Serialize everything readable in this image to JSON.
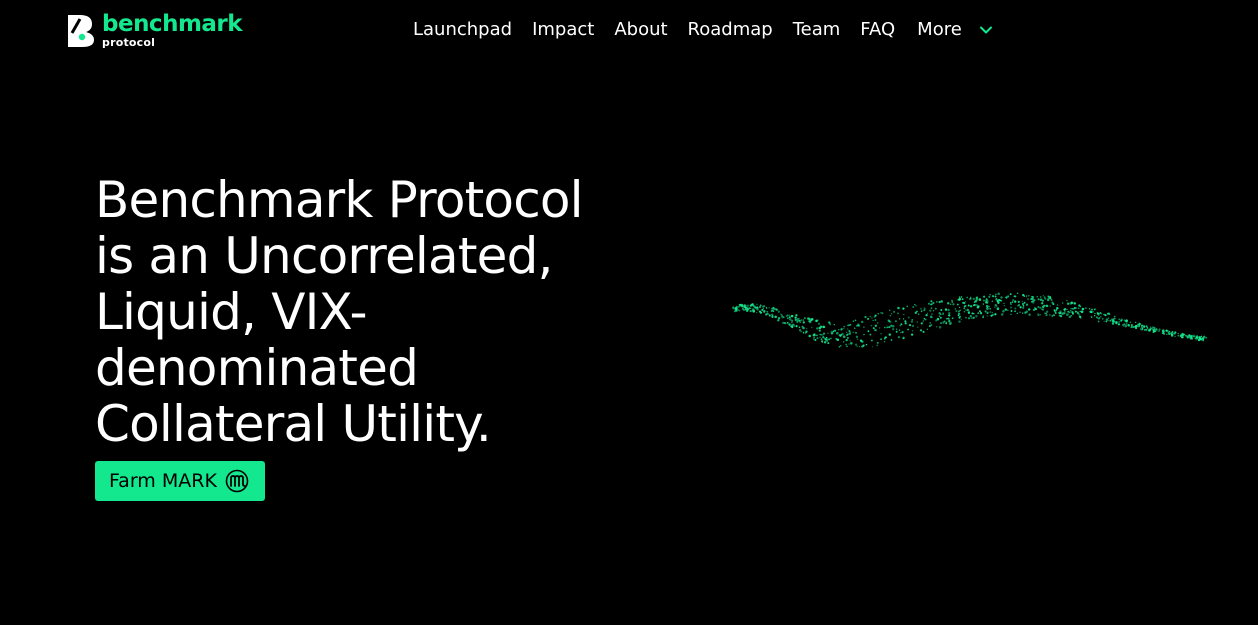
{
  "logo": {
    "name": "benchmark",
    "sub": "protocol"
  },
  "nav": {
    "items": [
      "Launchpad",
      "Impact",
      "About",
      "Roadmap",
      "Team",
      "FAQ"
    ],
    "more_label": "More"
  },
  "hero": {
    "title_lines": [
      "Benchmark Protocol",
      "is an Uncorrelated,",
      "Liquid, VIX-",
      "denominated",
      "Collateral Utility."
    ],
    "cta_label": "Farm MARK"
  },
  "colors": {
    "accent": "#14e88e",
    "background": "#000000",
    "text": "#ffffff"
  },
  "icons": {
    "logo": "benchmark-logo-icon",
    "chevron": "chevron-down-icon",
    "mark_token": "mark-token-icon",
    "wave": "particle-wave-graphic"
  }
}
